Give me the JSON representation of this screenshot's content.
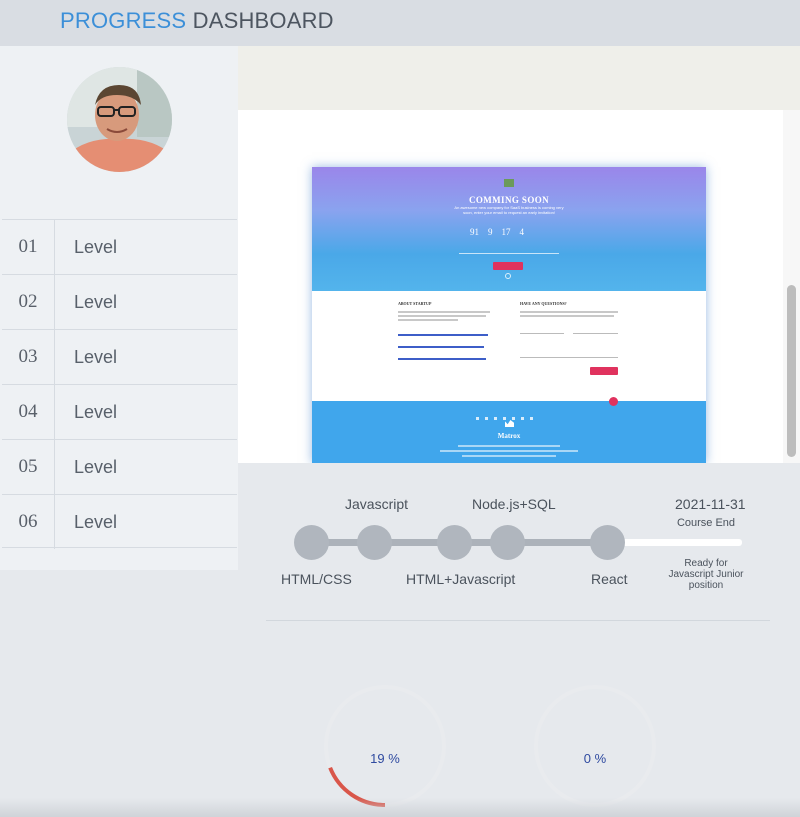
{
  "header": {
    "title_accent": "PROGRESS",
    "title_rest": "DASHBOARD"
  },
  "sidebar": {
    "avatar": "user-avatar",
    "levels": [
      {
        "number": "01",
        "label": "Level"
      },
      {
        "number": "02",
        "label": "Level"
      },
      {
        "number": "03",
        "label": "Level"
      },
      {
        "number": "04",
        "label": "Level"
      },
      {
        "number": "05",
        "label": "Level"
      },
      {
        "number": "06",
        "label": "Level"
      }
    ]
  },
  "preview": {
    "site_title": "COMMING SOON",
    "site_subtitle": "An awesome new company for SaaS business is coming very soon, enter your email to request an early invitation!",
    "countdown": [
      "91",
      "9",
      "17",
      "4"
    ],
    "about_heading": "ABOUT STARTUP",
    "questions_heading": "HAVE ANY QUESTIONS?",
    "footer_title": "Matrox"
  },
  "timeline": {
    "milestones_top": [
      "Javascript",
      "Node.js+SQL"
    ],
    "milestones_bottom": [
      "HTML/CSS",
      "HTML+Javascript",
      "React"
    ],
    "date": "2021-11-31",
    "end_label": "Course End",
    "goal_line1": "Ready for",
    "goal_line2": "Javascript Junior",
    "goal_line3": "position"
  },
  "progress": [
    {
      "value_text": "19 %",
      "fraction": 0.19
    },
    {
      "value_text": "0 %",
      "fraction": 0
    }
  ],
  "colors": {
    "accent": "#3c8fd8",
    "gauge_fill": "#d9564a",
    "gauge_track": "#e9ebee",
    "node": "#b0b6be"
  }
}
